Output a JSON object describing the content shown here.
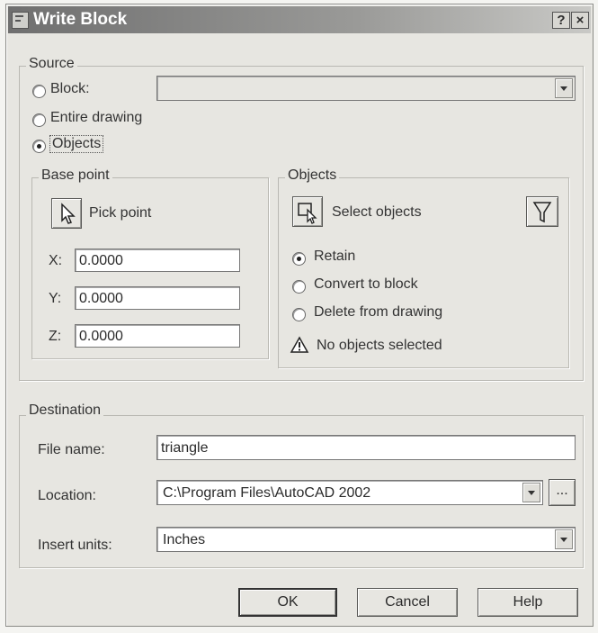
{
  "window": {
    "title": "Write Block",
    "help_glyph": "?",
    "close_glyph": "×"
  },
  "source": {
    "legend": "Source",
    "block_label": "Block:",
    "entire_drawing_label": "Entire drawing",
    "objects_label": "Objects",
    "selected": "objects",
    "block_value": ""
  },
  "base_point": {
    "legend": "Base point",
    "pick_point_label": "Pick point",
    "x_label": "X:",
    "x_value": "0.0000",
    "y_label": "Y:",
    "y_value": "0.0000",
    "z_label": "Z:",
    "z_value": "0.0000"
  },
  "objects": {
    "legend": "Objects",
    "select_label": "Select objects",
    "quick_select_glyph": "V",
    "retain_label": "Retain",
    "convert_label": "Convert to block",
    "delete_label": "Delete from drawing",
    "selected_mode": "retain",
    "status": "No objects selected"
  },
  "destination": {
    "legend": "Destination",
    "file_name_label": "File name:",
    "file_name_value": "triangle",
    "location_label": "Location:",
    "location_value": "C:\\Program Files\\AutoCAD 2002",
    "browse_label": "...",
    "insert_units_label": "Insert units:",
    "insert_units_value": "Inches"
  },
  "buttons": {
    "ok": "OK",
    "cancel": "Cancel",
    "help": "Help"
  },
  "icons": {
    "title": "dialog-app-icon",
    "pick_point": "pick-point-cursor-icon",
    "select_objects": "select-objects-icon",
    "quick_select": "quick-select-funnel-icon",
    "warning": "warning-icon",
    "dropdown": "dropdown-arrow-icon"
  }
}
